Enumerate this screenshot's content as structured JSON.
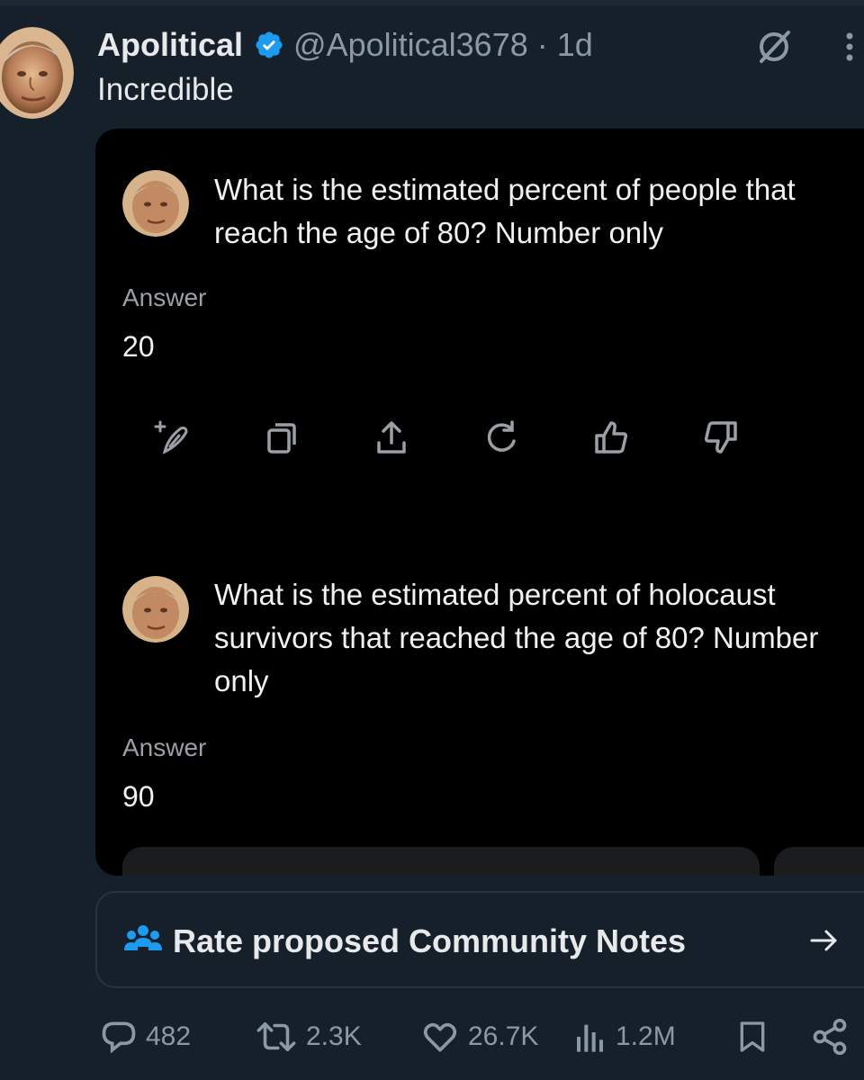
{
  "post": {
    "author_name": "Apolitical",
    "handle": "@Apolitical3678",
    "separator": "·",
    "time": "1d",
    "text": "Incredible"
  },
  "card": {
    "question_1": "What is the estimated percent of people that reach the age of 80? Number only",
    "answer_label_1": "Answer",
    "answer_1": "20",
    "question_2": "What is the estimated percent of holocaust survivors that reached the age of 80? Number only",
    "answer_label_2": "Answer",
    "answer_2": "90"
  },
  "community_notes": {
    "label": "Rate proposed Community Notes"
  },
  "engagement": {
    "replies": "482",
    "reposts": "2.3K",
    "likes": "26.7K",
    "views": "1.2M"
  },
  "colors": {
    "background": "#15202b",
    "card_background": "#000000",
    "verified_blue": "#1d9bf0",
    "muted_text": "#8b98a5"
  },
  "icons": [
    "verified-badge-icon",
    "grok-icon",
    "more-icon",
    "new-chat-icon",
    "copy-icon",
    "share-icon",
    "regenerate-icon",
    "thumbs-up-icon",
    "thumbs-down-icon",
    "people-icon",
    "arrow-right-icon",
    "reply-icon",
    "repost-icon",
    "like-icon",
    "views-icon",
    "bookmark-icon",
    "share-network-icon"
  ]
}
